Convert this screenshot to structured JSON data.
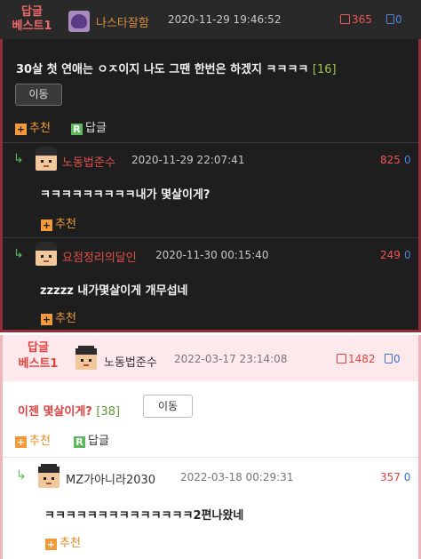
{
  "top_post": {
    "best_label_line1": "답글",
    "best_label_line2": "베스트1",
    "author": "나스타잘함",
    "date": "2020-11-29 19:46:52",
    "upvotes": "365",
    "downvotes": "0",
    "title": "30살 첫 연애는 ㅇㅈ이지 나도 그땐 한번은 하겠지 ㅋㅋㅋㅋ",
    "comment_count": "[16]",
    "move_button": "이동",
    "recommend_label": "추천",
    "reply_label": "답글",
    "reply_icon_letter": "R",
    "recommend_icon_letter": "+",
    "comments": [
      {
        "arrow": "↳",
        "author": "노동법준수",
        "date": "2020-11-29 22:07:41",
        "score": "825",
        "down": "0",
        "text": "ㅋㅋㅋㅋㅋㅋㅋㅋㅋ내가 몇살이게?",
        "recommend_label": "추천"
      },
      {
        "arrow": "↳",
        "author": "요점정리의달인",
        "date": "2020-11-30 00:15:40",
        "score": "249",
        "down": "0",
        "text": "zzzzz 내가몇살이게 개무섭네",
        "recommend_label": "추천"
      }
    ]
  },
  "bottom_post": {
    "best_label_line1": "답글",
    "best_label_line2": "베스트1",
    "author": "노동법준수",
    "date": "2022-03-17 23:14:08",
    "upvotes": "1482",
    "downvotes": "0",
    "title": "이젠 몇살이게?",
    "comment_count": "[38]",
    "move_button": "이동",
    "recommend_label": "추천",
    "reply_label": "답글",
    "reply_icon_letter": "R",
    "recommend_icon_letter": "+",
    "comment": {
      "arrow": "↳",
      "author": "MZ가아니라2030",
      "date": "2022-03-18 00:29:31",
      "score": "357",
      "down": "0",
      "text": "ㅋㅋㅋㅋㅋㅋㅋㅋㅋㅋㅋㅋㅋㅋ2편나왔네",
      "recommend_label": "추천"
    }
  },
  "colors": {
    "dark_bg": "#1e1e1e",
    "accent_red": "#e4413f",
    "accent_orange": "#f29a38",
    "reply_green": "#5cb85c",
    "down_blue": "#3b6fd0",
    "best_bg": "#fde9eb"
  },
  "icons": {
    "avatar_top": "purple-blob-avatar-icon",
    "avatar_comment": "pixel-face-avatar-icon",
    "thumb_up": "thumbs-up-icon",
    "thumb_down": "thumbs-down-icon",
    "reply_arrow": "reply-arrow-icon"
  }
}
